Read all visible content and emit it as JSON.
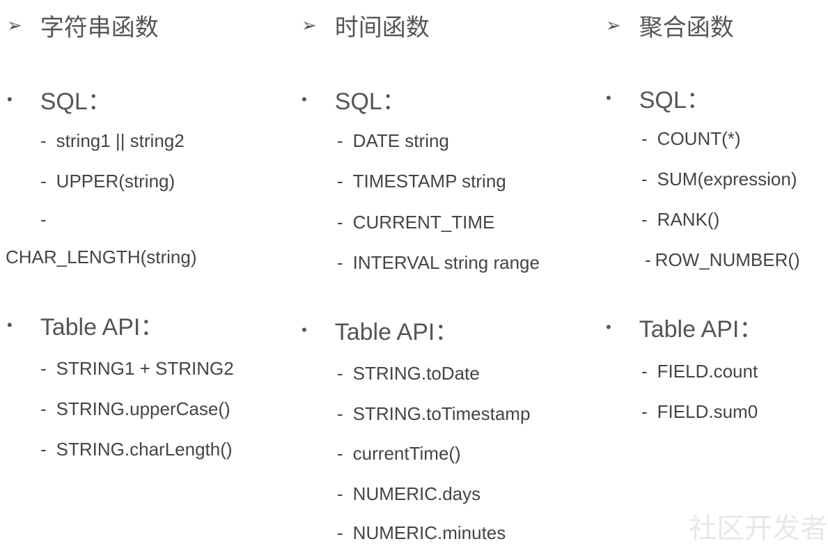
{
  "columns": [
    {
      "heading": "字符串函数",
      "sql_label": "SQL：",
      "sql_items": [
        "string1 || string2",
        "UPPER(string)",
        "-",
        "CHAR_LENGTH(string)"
      ],
      "api_label": "Table API：",
      "api_items": [
        "STRING1 + STRING2",
        "STRING.upperCase()",
        "STRING.charLength()"
      ]
    },
    {
      "heading": "时间函数",
      "sql_label": "SQL：",
      "sql_items": [
        "DATE string",
        "TIMESTAMP string",
        "CURRENT_TIME",
        "INTERVAL string range"
      ],
      "api_label": "Table API：",
      "api_items": [
        "STRING.toDate",
        "STRING.toTimestamp",
        "currentTime()",
        "NUMERIC.days",
        "NUMERIC.minutes"
      ]
    },
    {
      "heading": "聚合函数",
      "sql_label": "SQL：",
      "sql_items": [
        "COUNT(*)",
        "SUM(expression)",
        "RANK()",
        "ROW_NUMBER()"
      ],
      "api_label": "Table API：",
      "api_items": [
        "FIELD.count",
        "FIELD.sum0"
      ]
    }
  ],
  "symbols": {
    "arrow": "➢",
    "bullet": "•",
    "dash": "-"
  },
  "watermark": "社区开发者"
}
